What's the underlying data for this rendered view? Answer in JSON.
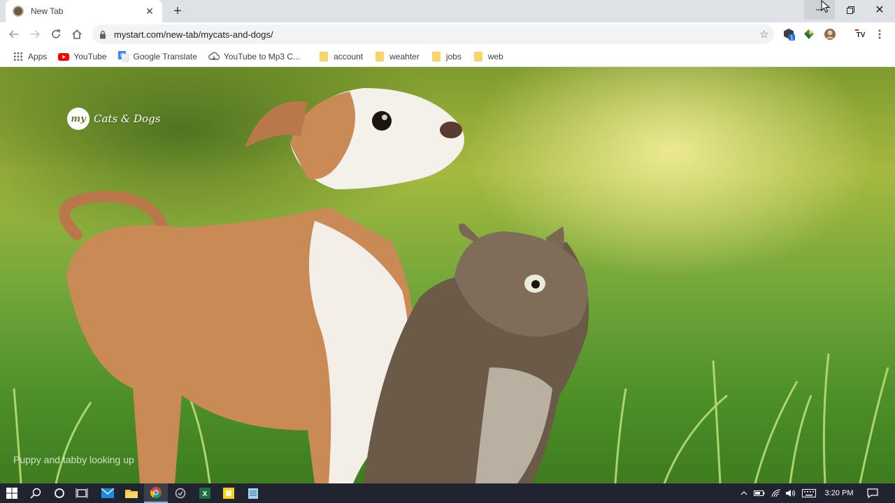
{
  "browser": {
    "tab": {
      "title": "New Tab"
    },
    "address_bar": {
      "url": "mystart.com/new-tab/mycats-and-dogs/"
    }
  },
  "bookmarks": [
    {
      "label": "Apps",
      "icon": "apps-grid-icon"
    },
    {
      "label": "YouTube",
      "icon": "youtube-icon"
    },
    {
      "label": "Google Translate",
      "icon": "google-translate-icon"
    },
    {
      "label": "YouTube to Mp3 C...",
      "icon": "cloud-download-icon"
    },
    {
      "label": "account",
      "icon": "folder-icon"
    },
    {
      "label": "weahter",
      "icon": "folder-icon"
    },
    {
      "label": "jobs",
      "icon": "folder-icon"
    },
    {
      "label": "web",
      "icon": "folder-icon"
    }
  ],
  "page": {
    "logo_badge": "my",
    "logo_text": "Cats & Dogs",
    "caption": "Puppy and tabby looking up"
  },
  "extensions": {
    "badge_count": "1",
    "tv_label": "TV"
  },
  "taskbar": {
    "clock": "3:20 PM"
  },
  "colors": {
    "accent": "#1a73e8",
    "taskbar": "#1f2430",
    "tab_strip": "#dee1e6"
  }
}
